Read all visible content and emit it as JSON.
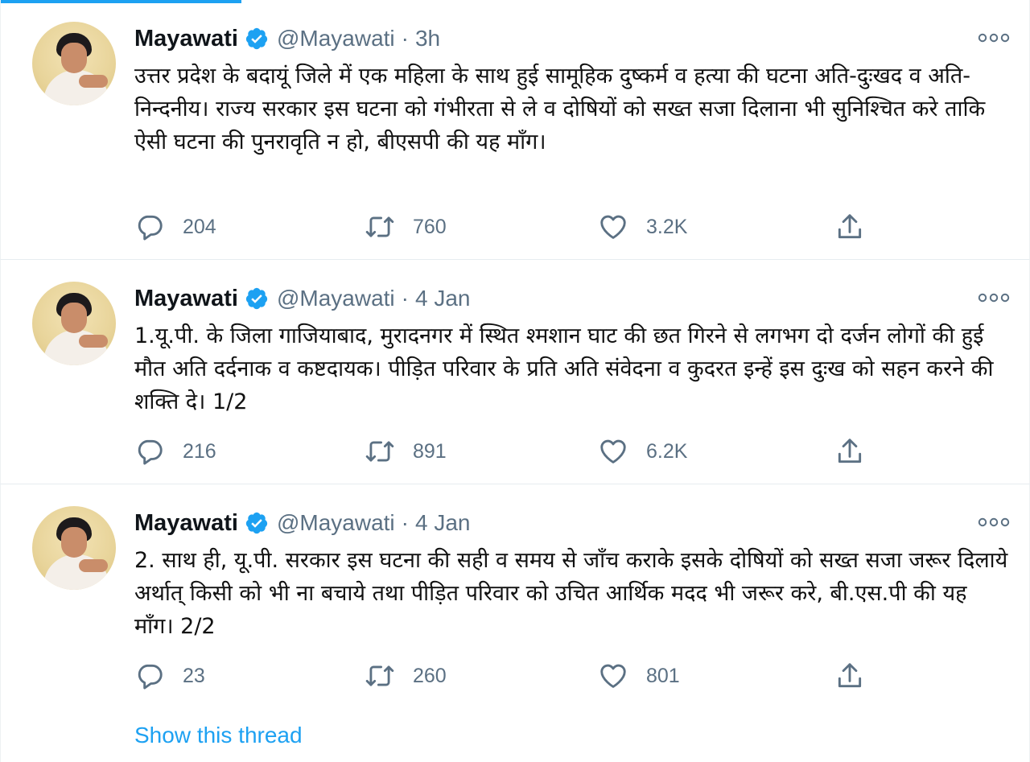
{
  "tweets": [
    {
      "name": "Mayawati",
      "handle": "@Mayawati",
      "time": "3h",
      "text": "उत्तर प्रदेश के बदायूं जिले में एक महिला के साथ हुई सामूहिक दुष्कर्म व हत्या की घटना अति-दुःखद व अति-निन्दनीय। राज्य सरकार इस घटना को गंभीरता से ले व दोषियों को सख्त सजा दिलाना भी सुनिश्चित करे ताकि ऐसी घटना की पुनरावृति न हो, बीएसपी की यह माँग।",
      "replies": "204",
      "retweets": "760",
      "likes": "3.2K"
    },
    {
      "name": "Mayawati",
      "handle": "@Mayawati",
      "time": "4 Jan",
      "text": "1.यू.पी. के जिला गाजियाबाद, मुरादनगर में स्थित श्मशान घाट की छत गिरने से लगभग दो दर्जन लोगों की हुई मौत अति दर्दनाक व कष्टदायक। पीड़ित परिवार के प्रति अति संवेदना व कुदरत इन्हें इस दुःख को सहन करने की शक्ति दे। 1/2",
      "replies": "216",
      "retweets": "891",
      "likes": "6.2K"
    },
    {
      "name": "Mayawati",
      "handle": "@Mayawati",
      "time": "4 Jan",
      "text": "2. साथ ही, यू.पी. सरकार इस घटना की सही व समय से  जाँच कराके इसके दोषियों को सख्त सजा जरूर दिलाये अर्थात् किसी को भी ना बचाये तथा पीड़ित परिवार को उचित आर्थिक मदद भी जरूर करे, बी.एस.पी की यह माँग। 2/2",
      "replies": "23",
      "retweets": "260",
      "likes": "801"
    }
  ],
  "show_thread_label": "Show this thread",
  "dot_separator": "·",
  "colors": {
    "accent": "#1da1f2",
    "secondary_text": "#5b7083",
    "divider": "#e6ecf0"
  },
  "icons": {
    "verified": "verified-badge-icon",
    "more": "more-options-icon",
    "reply": "reply-icon",
    "retweet": "retweet-icon",
    "like": "heart-icon",
    "share": "share-icon"
  }
}
